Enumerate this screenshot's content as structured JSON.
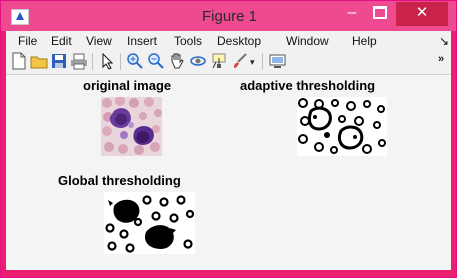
{
  "window": {
    "title": "Figure 1",
    "minimize_glyph": "–",
    "close_glyph": "✕"
  },
  "menu": {
    "items": [
      "File",
      "Edit",
      "View",
      "Insert",
      "Tools",
      "Desktop",
      "Window",
      "Help"
    ],
    "overflow_glyph": "↘"
  },
  "toolbar": {
    "icons": [
      "new-figure-icon",
      "open-file-icon",
      "save-icon",
      "print-icon",
      "edit-plot-arrow-icon",
      "zoom-in-icon",
      "zoom-out-icon",
      "pan-hand-icon",
      "rotate-3d-icon",
      "data-cursor-icon",
      "brush-icon",
      "brush-dropdown-icon",
      "link-plot-icon"
    ],
    "overflow_glyph": "»"
  },
  "figure": {
    "panels": [
      {
        "title": "original image"
      },
      {
        "title": "adaptive thresholding"
      },
      {
        "title": "Global thresholding"
      }
    ]
  },
  "colors": {
    "frame": "#e8206f",
    "titlebar": "#ee4a90",
    "close_button": "#c9224b",
    "cell_stain": "#5b2a8f"
  }
}
